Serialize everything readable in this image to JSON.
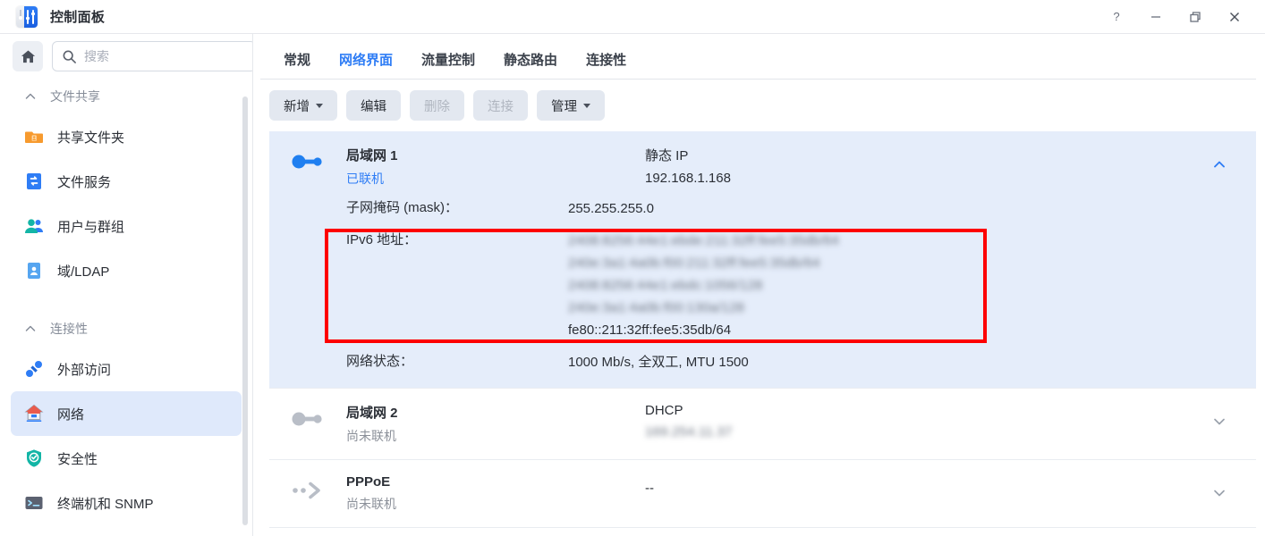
{
  "window": {
    "title": "控制面板",
    "app_icon": "control-panel-icon",
    "controls": [
      {
        "name": "help-button",
        "glyph": "?"
      },
      {
        "name": "minimize-button",
        "glyph": "−"
      },
      {
        "name": "restore-button",
        "glyph": "❐"
      },
      {
        "name": "close-button",
        "glyph": "✕"
      }
    ]
  },
  "sidebar": {
    "home_icon": "home-icon",
    "search": {
      "placeholder": "搜索",
      "value": "",
      "icon": "search-icon"
    },
    "groups": [
      {
        "label": "文件共享",
        "icon": "chevron-up-icon",
        "items": [
          {
            "label": "共享文件夹",
            "icon": "shared-folder-icon",
            "active": false
          },
          {
            "label": "文件服务",
            "icon": "file-service-icon",
            "active": false
          },
          {
            "label": "用户与群组",
            "icon": "users-groups-icon",
            "active": false
          },
          {
            "label": "域/LDAP",
            "icon": "domain-ldap-icon",
            "active": false
          }
        ]
      },
      {
        "label": "连接性",
        "icon": "chevron-up-icon",
        "items": [
          {
            "label": "外部访问",
            "icon": "external-access-icon",
            "active": false
          },
          {
            "label": "网络",
            "icon": "network-icon",
            "active": true
          },
          {
            "label": "安全性",
            "icon": "security-icon",
            "active": false
          },
          {
            "label": "终端机和 SNMP",
            "icon": "terminal-snmp-icon",
            "active": false
          }
        ]
      }
    ]
  },
  "main": {
    "tabs": [
      {
        "label": "常规",
        "active": false
      },
      {
        "label": "网络界面",
        "active": true
      },
      {
        "label": "流量控制",
        "active": false
      },
      {
        "label": "静态路由",
        "active": false
      },
      {
        "label": "连接性",
        "active": false
      }
    ],
    "toolbar": [
      {
        "label": "新增",
        "dropdown": true,
        "disabled": false
      },
      {
        "label": "编辑",
        "dropdown": false,
        "disabled": false
      },
      {
        "label": "删除",
        "dropdown": false,
        "disabled": true
      },
      {
        "label": "连接",
        "dropdown": false,
        "disabled": true
      },
      {
        "label": "管理",
        "dropdown": true,
        "disabled": false
      }
    ],
    "interfaces": [
      {
        "name": "局域网 1",
        "status": "已联机",
        "status_state": "online",
        "mode": "静态 IP",
        "ip": "192.168.1.168",
        "ip_blurred": false,
        "icon": "lan-connected-icon",
        "expanded": true,
        "chevron": "chevron-up-icon",
        "details": [
          {
            "label": "子网掩码 (mask)：",
            "values": [
              {
                "text": "255.255.255.0",
                "blurred": false
              }
            ]
          },
          {
            "label": "IPv6 地址：",
            "values": [
              {
                "text": "2408:8256:44e1:ebde:211:32ff:fee5:35db/64",
                "blurred": true
              },
              {
                "text": "240e:3a1:4a0b:f00:211:32ff:fee5:35db/64",
                "blurred": true
              },
              {
                "text": "2408:8256:44e1:ebdc:1056/128",
                "blurred": true
              },
              {
                "text": "240e:3a1:4a0b:f00:130a/128",
                "blurred": true
              },
              {
                "text": "fe80::211:32ff:fee5:35db/64",
                "blurred": false
              }
            ]
          },
          {
            "label": "网络状态：",
            "values": [
              {
                "text": "1000 Mb/s, 全双工, MTU 1500",
                "blurred": false
              }
            ]
          }
        ]
      },
      {
        "name": "局域网 2",
        "status": "尚未联机",
        "status_state": "offline",
        "mode": "DHCP",
        "ip": "169.254.11.37",
        "ip_blurred": true,
        "icon": "lan-disconnected-icon",
        "expanded": false,
        "chevron": "chevron-down-icon",
        "details": []
      },
      {
        "name": "PPPoE",
        "status": "尚未联机",
        "status_state": "offline",
        "mode": "",
        "ip": "--",
        "ip_blurred": false,
        "icon": "pppoe-icon",
        "expanded": false,
        "chevron": "chevron-down-icon",
        "details": []
      }
    ],
    "annotation": {
      "name": "red-highlight-box",
      "color": "#fd0000"
    }
  },
  "colors": {
    "accent": "#2f7df5",
    "selected_row": "#e5edfa",
    "sidebar_active": "#dfe9fb",
    "toolbar_button": "#e3e8f0",
    "annotation": "#fd0000"
  }
}
